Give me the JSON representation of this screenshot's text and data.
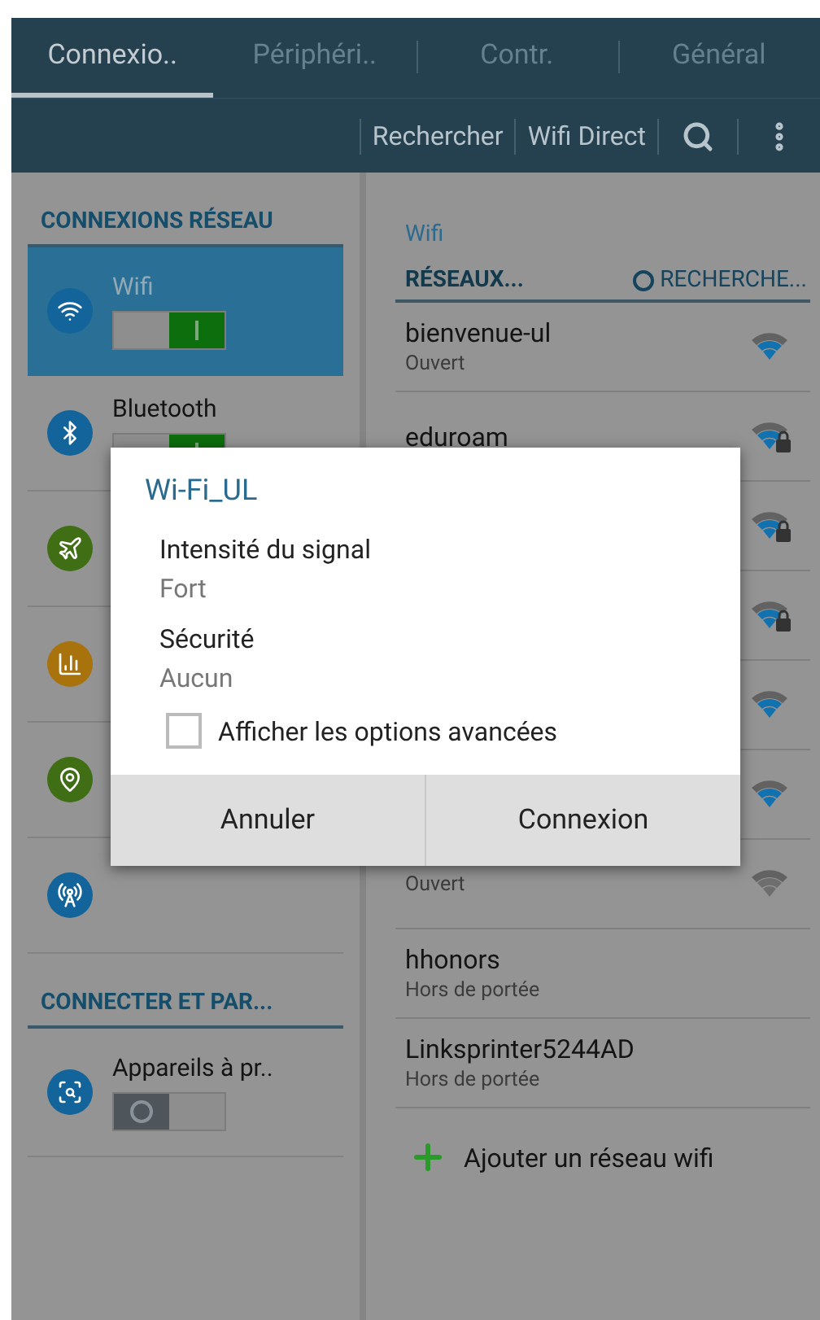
{
  "tabs": [
    {
      "label": "Connexio..",
      "selected": true
    },
    {
      "label": "Périphéri..",
      "selected": false
    },
    {
      "label": "Contr.",
      "selected": false
    },
    {
      "label": "Général",
      "selected": false
    }
  ],
  "action_bar": {
    "actions": [
      "Rechercher",
      "Wifi Direct"
    ]
  },
  "sidebar": {
    "sections": [
      {
        "title": "CONNEXIONS RÉSEAU",
        "items": [
          {
            "kind": "wifi",
            "label": "Wifi",
            "selected": true,
            "on": true,
            "color": "#12649a"
          },
          {
            "kind": "bluetooth",
            "label": "Bluetooth",
            "selected": false,
            "on": true,
            "color": "#12649a"
          },
          {
            "kind": "airplane",
            "selected": false,
            "color": "#3f6e14"
          },
          {
            "kind": "data",
            "selected": false,
            "color": "#a8720c"
          },
          {
            "kind": "location",
            "selected": false,
            "color": "#3f6e14"
          },
          {
            "kind": "tethering",
            "selected": false,
            "color": "#12649a"
          }
        ]
      },
      {
        "title": "CONNECTER ET PAR...",
        "items": [
          {
            "kind": "nearby",
            "label": "Appareils à pr..",
            "selected": false,
            "on": false,
            "color": "#12649a"
          }
        ]
      }
    ]
  },
  "detail": {
    "title": "Wifi",
    "list_title": "RÉSEAUX...",
    "scan_label": "RECHERCHE...",
    "networks": [
      {
        "name": "bienvenue-ul",
        "status": "Ouvert",
        "locked": false,
        "color": "#1272b0"
      },
      {
        "name": "eduroam",
        "locked": true,
        "color": "#1272b0"
      },
      {
        "locked": true,
        "color": "#1272b0"
      },
      {
        "locked": true,
        "color": "#1272b0"
      },
      {
        "locked": false,
        "color": "#1272b0"
      },
      {
        "locked": false,
        "color": "#1272b0"
      },
      {
        "status": "Ouvert",
        "locked": false,
        "color": "#6e6e6e"
      },
      {
        "name": "hhonors",
        "status": "Hors de portée"
      },
      {
        "name": "Linksprinter5244AD",
        "status": "Hors de portée"
      }
    ],
    "add_label": "Ajouter un réseau wifi"
  },
  "dialog": {
    "title": "Wi-Fi_UL",
    "fields": [
      {
        "label": "Intensité du signal",
        "value": "Fort"
      },
      {
        "label": "Sécurité",
        "value": "Aucun"
      }
    ],
    "advanced": {
      "label": "Afficher les options avancées",
      "checked": false
    },
    "buttons": [
      "Annuler",
      "Connexion"
    ]
  }
}
